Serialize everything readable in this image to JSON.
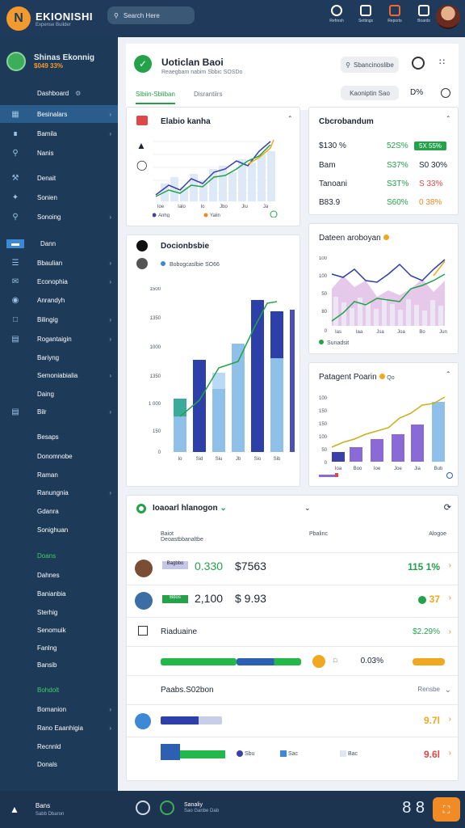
{
  "app": {
    "title": "EKIONISHI",
    "subtitle": "Expense Builder",
    "search": "Search Here"
  },
  "topbar": {
    "tools": [
      {
        "icon": "refresh-icon",
        "label": "Refresh"
      },
      {
        "icon": "tools-icon",
        "label": "Settings"
      },
      {
        "icon": "flag-icon",
        "label": "Reports"
      },
      {
        "icon": "grid-icon",
        "label": "Boards"
      }
    ]
  },
  "sidebar": {
    "user_name": "Shinas Ekonnig",
    "user_badge": "$049 33%",
    "section": "Dashboard",
    "items": [
      {
        "label": "Besinalars",
        "icon": "calendar-icon",
        "chevron": true,
        "active": true
      },
      {
        "label": "Bamila",
        "icon": "ruler-icon",
        "chevron": true
      },
      {
        "label": "Nanis",
        "icon": "help-icon",
        "chevron": false
      },
      {
        "label": "Denait",
        "icon": "wrench-icon",
        "chevron": false
      },
      {
        "label": "Sonien",
        "icon": "star-icon",
        "chevron": false
      },
      {
        "label": "Sonoing",
        "icon": "search-icon",
        "chevron": true
      },
      {
        "label": "Dann",
        "icon": "card-icon",
        "chevron": false,
        "active2": true
      },
      {
        "label": "Bbaulian",
        "icon": "stack-icon",
        "chevron": true
      },
      {
        "label": "Econophia",
        "icon": "mail-icon",
        "chevron": true
      },
      {
        "label": "Anrandyh",
        "icon": "globe-icon",
        "chevron": false
      },
      {
        "label": "Bilingig",
        "icon": "box-icon",
        "chevron": true
      },
      {
        "label": "Rogantaigin",
        "icon": "book-icon",
        "chevron": true
      },
      {
        "label": "Bariyng",
        "icon": "",
        "chevron": false
      },
      {
        "label": "Semoniabialia",
        "icon": "",
        "chevron": true
      },
      {
        "label": "Daing",
        "icon": "",
        "chevron": false
      },
      {
        "label": "Bilr",
        "icon": "doc-icon",
        "chevron": true
      },
      {
        "label": "Besaps",
        "icon": "",
        "chevron": false
      },
      {
        "label": "Donomnobe",
        "icon": "",
        "chevron": false
      },
      {
        "label": "Raman",
        "icon": "",
        "chevron": false
      },
      {
        "label": "Ranungnia",
        "icon": "",
        "chevron": true
      },
      {
        "label": "Gdanra",
        "icon": "",
        "chevron": false
      },
      {
        "label": "Sonighuan",
        "icon": "",
        "chevron": false
      },
      {
        "label": "Doans",
        "icon": "",
        "chevron": false,
        "green": true
      },
      {
        "label": "Dahnes",
        "icon": "",
        "chevron": false
      },
      {
        "label": "Banianbia",
        "icon": "",
        "chevron": false
      },
      {
        "label": "Sterhig",
        "icon": "",
        "chevron": false
      },
      {
        "label": "Senomuik",
        "icon": "",
        "chevron": false
      },
      {
        "label": "Fanlng",
        "icon": "",
        "chevron": false
      },
      {
        "label": "Bansib",
        "icon": "",
        "chevron": false
      },
      {
        "label": "Bohdolt",
        "icon": "",
        "chevron": false,
        "green": true
      },
      {
        "label": "Bomanion",
        "icon": "",
        "chevron": true
      },
      {
        "label": "Rano Eaanhigia",
        "icon": "",
        "chevron": true
      },
      {
        "label": "Recnnld",
        "icon": "",
        "chevron": false
      },
      {
        "label": "Donals",
        "icon": "",
        "chevron": false
      }
    ]
  },
  "header": {
    "title": "Uoticlan Baoi",
    "subtitle": "Reaegbam nabim Sbbic SOSDo",
    "search_pill": "Sbancinoslibe",
    "filter_pill": "Kaoniptin Sao",
    "percent": "D%",
    "tabs": [
      "Sibiin-Sbliban",
      "Disrantiirs"
    ]
  },
  "card_trend": {
    "title": "Elabio kanha",
    "legend": [
      "Anhg",
      "Yalin"
    ],
    "x": [
      "Ioe",
      "Ialo",
      "Io",
      "Jbo",
      "Jiu",
      "Ja"
    ]
  },
  "card_stats": {
    "title": "Cbcrobandum",
    "rows": [
      {
        "left": "$130 %",
        "leftc": "green",
        "pct": "52S%",
        "right": "5X 55%",
        "rightc": "badge"
      },
      {
        "left": "Bam",
        "leftc": "blue",
        "pct": "S37%",
        "right": "S0 30%",
        "rightc": "dark"
      },
      {
        "left": "Tanoani",
        "leftc": "dark",
        "pct": "S3T%",
        "right": "S 33%",
        "rightc": "red"
      },
      {
        "left": "B83.9",
        "leftc": "dark",
        "pct": "S60%",
        "right": "0 38%",
        "rightc": "orange"
      }
    ]
  },
  "card_bars": {
    "title": "Docionbsbie",
    "legend": "Bobogcaslbie SO66",
    "y": [
      "1500",
      "1350",
      "1000",
      "1350",
      "1 000",
      "150",
      "0"
    ],
    "x": [
      "Io",
      "Sid",
      "Siu",
      "Jb",
      "Sio",
      "Sib"
    ]
  },
  "card_area": {
    "title": "Dateen aroboyan",
    "legend": "Sunadsit",
    "y": [
      "100",
      "100",
      "50",
      "80",
      "0"
    ],
    "x": [
      "Ias",
      "Iaa",
      "Jsa",
      "Joa",
      "Bo",
      "Jun"
    ]
  },
  "card_bar2": {
    "title": "Patagent Poarin",
    "sub": "Qo",
    "y": [
      "100",
      "150",
      "150",
      "100",
      "50",
      "0"
    ],
    "x": [
      "Ioa",
      "Boo",
      "Ioe",
      "Joe",
      "Jia",
      "Bub"
    ]
  },
  "table": {
    "title": "Ioaoarl hlanogon",
    "cols": [
      "Baiot Deoastbbanaltbe",
      "Pbalinc",
      "Alogoe"
    ],
    "rows": [
      {
        "tag": "Bagbbo",
        "amount": "0.330",
        "price": "$7563",
        "value": "115 1%"
      },
      {
        "tag": "Bdos",
        "amount": "2,100",
        "price": "$ 9.93",
        "value": "37"
      },
      {
        "name": "Riaduaine",
        "value": "$2.29%"
      },
      {
        "pct": "0.03%"
      },
      {
        "name": "Paabs.S02bon",
        "value": "Rensbe"
      },
      {
        "value": "9.7l"
      },
      {
        "leg": [
          "Sbu",
          "Sac",
          "Bac"
        ],
        "value": "9.6l"
      }
    ]
  },
  "bottom": {
    "left": "Bans",
    "left_sub": "Sabb Dbaron",
    "center": "Sanaliy",
    "center_sub": "Sao Ganbe Dab",
    "right": "8 8"
  },
  "colors": {
    "green": "#23a24a",
    "blue": "#2d5fb3",
    "orange": "#f0882a",
    "navy": "#1d3a58"
  }
}
